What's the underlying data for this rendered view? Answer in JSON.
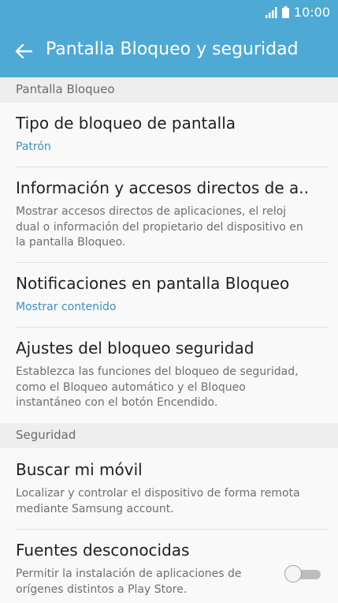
{
  "status_bar": {
    "time": "10:00"
  },
  "app_bar": {
    "title": "Pantalla Bloqueo y seguridad"
  },
  "sections": [
    {
      "header": "Pantalla Bloqueo"
    },
    {
      "header": "Seguridad"
    }
  ],
  "items": [
    {
      "title": "Tipo de bloqueo de pantalla",
      "subtitle": "Patrón"
    },
    {
      "title": "Información y accesos directos de a..",
      "subtitle": "Mostrar accesos directos de aplicaciones, el reloj dual o información del propietario del dispositivo en la pantalla Bloqueo."
    },
    {
      "title": "Notificaciones en pantalla Bloqueo",
      "subtitle": "Mostrar contenido"
    },
    {
      "title": "Ajustes del bloqueo seguridad",
      "subtitle": "Establezca las funciones del bloqueo de seguridad, como el Bloqueo automático y el Bloqueo instantáneo con el botón Encendido."
    },
    {
      "title": "Buscar mi móvil",
      "subtitle": "Localizar y controlar el dispositivo de forma remota mediante Samsung account."
    },
    {
      "title": "Fuentes desconocidas",
      "subtitle": "Permitir la instalación de aplicaciones de orígenes distintos a Play Store.",
      "toggle_on": false
    }
  ],
  "colors": {
    "accent": "#4fa9d5",
    "link": "#3b8fc4"
  }
}
